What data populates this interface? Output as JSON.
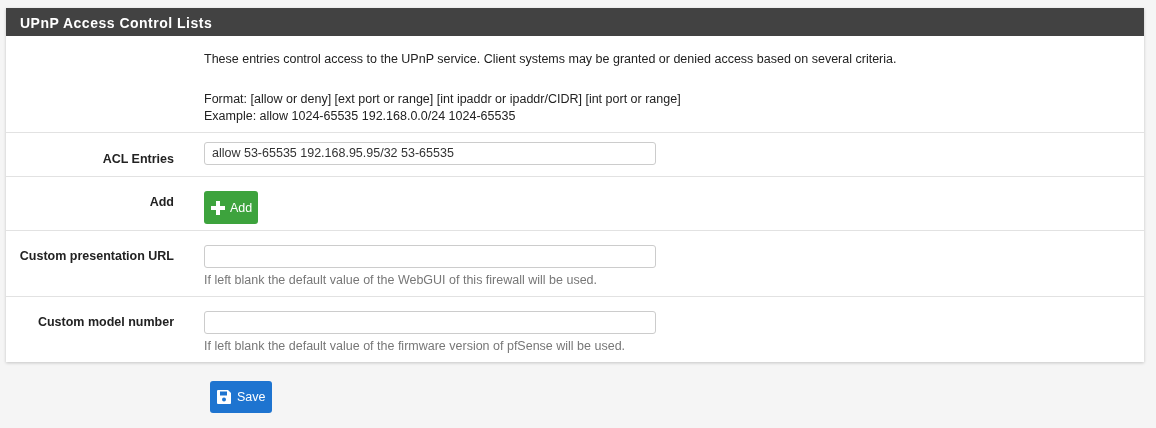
{
  "panel": {
    "title": "UPnP Access Control Lists"
  },
  "intro": [
    "These entries control access to the UPnP service. Client systems may be granted or denied access based on several criteria.",
    "Format: [allow or deny] [ext port or range] [int ipaddr or ipaddr/CIDR] [int port or range]",
    "Example: allow 1024-65535 192.168.0.0/24 1024-65535"
  ],
  "rows": [
    {
      "kind": "input",
      "label": "ACL Entries",
      "value": "allow 53-65535 192.168.95.95/32 53-65535"
    },
    {
      "kind": "button",
      "label": "Add",
      "button": "Add"
    },
    {
      "kind": "input",
      "label": "Custom presentation URL",
      "help": "If left blank the default value of the WebGUI of this firewall will be used."
    },
    {
      "kind": "input",
      "label": "Custom model number",
      "help": "If left blank the default value of the firmware version of pfSense will be used."
    }
  ],
  "save_button": "Save"
}
